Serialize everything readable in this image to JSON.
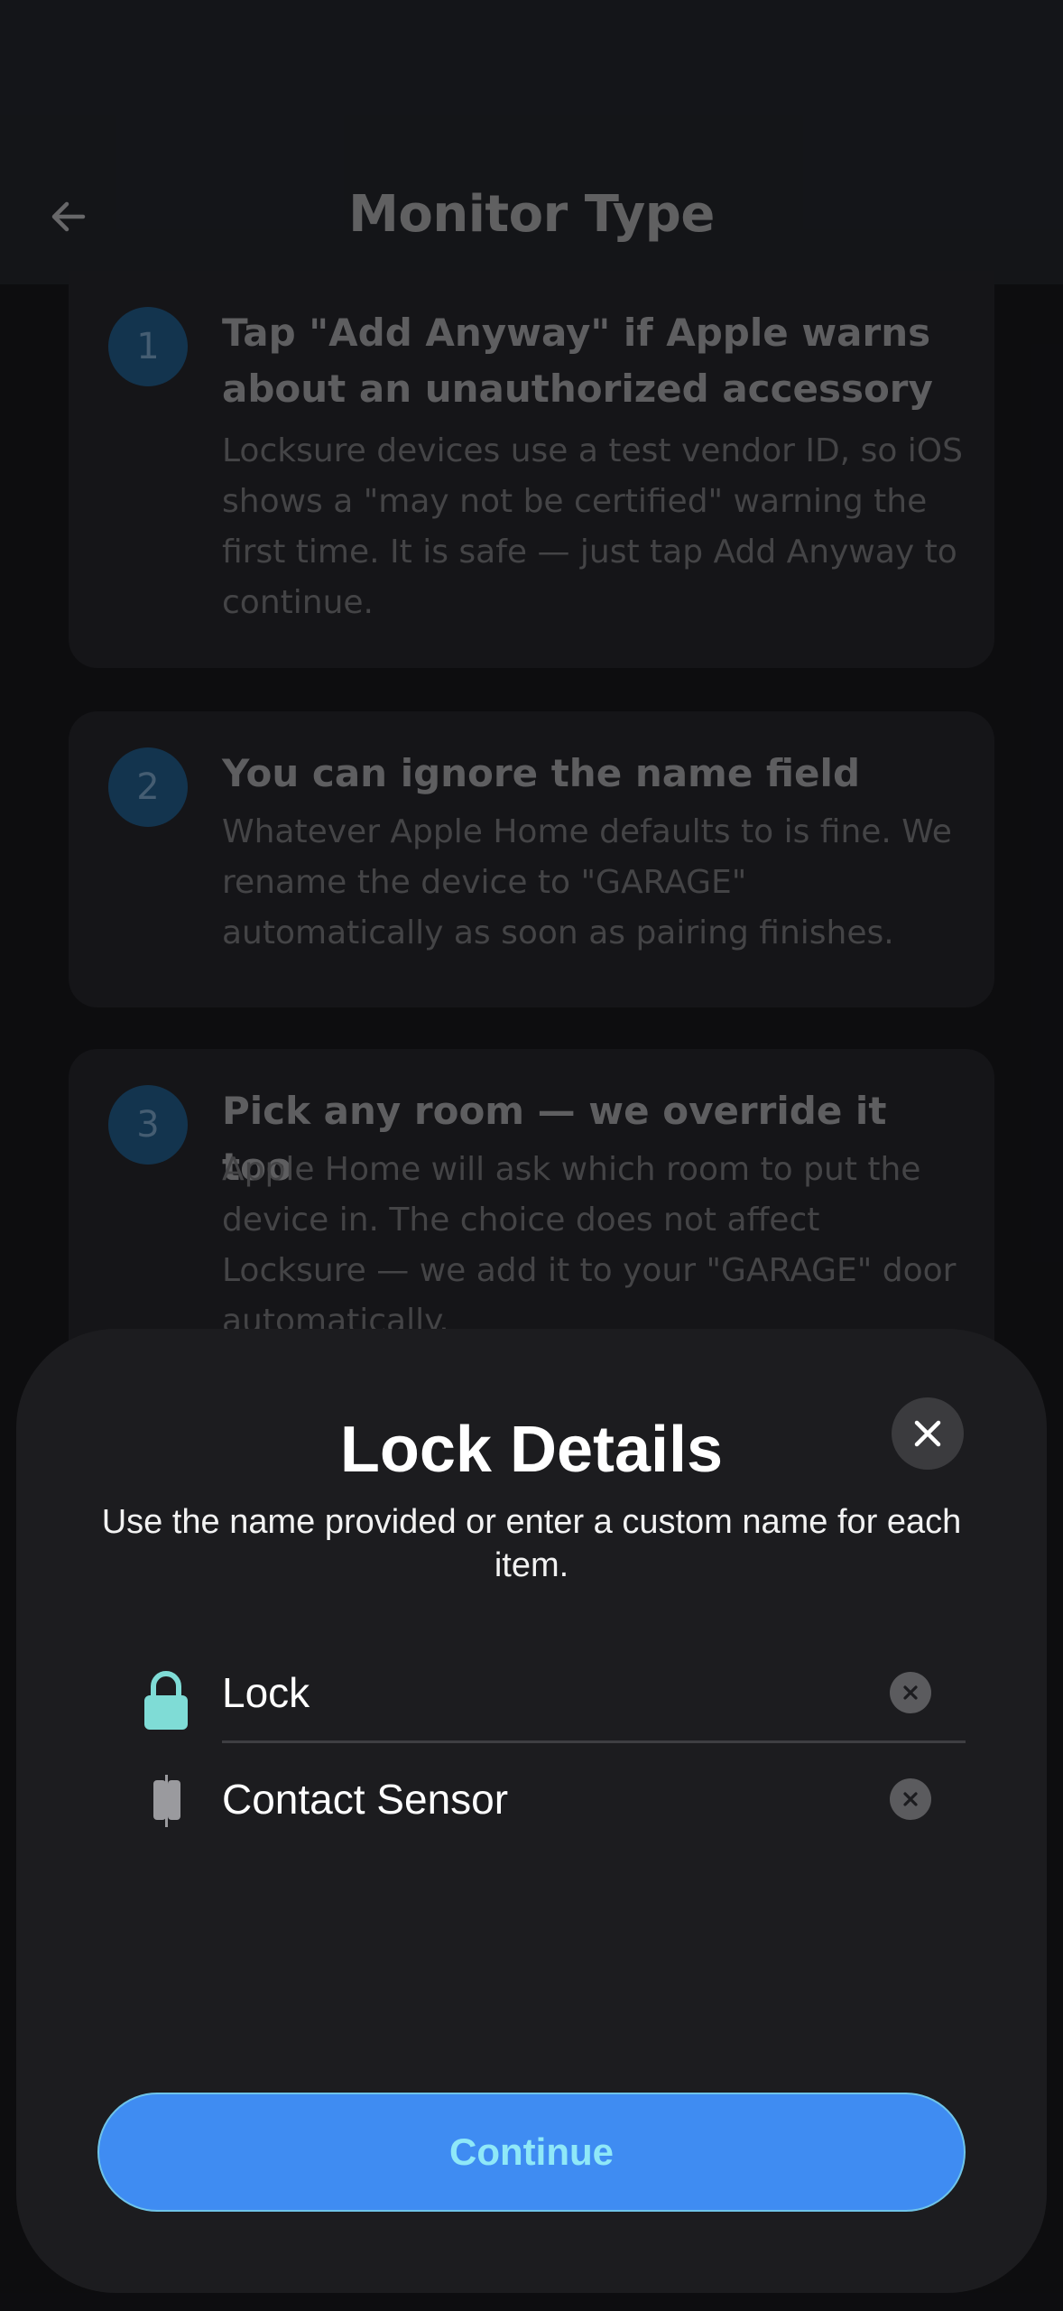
{
  "header": {
    "title": "Monitor Type"
  },
  "steps": [
    {
      "number": "1",
      "title": "Tap \"Add Anyway\" if Apple warns about an unauthorized accessory",
      "body": "Locksure devices use a test vendor ID, so iOS shows a \"may not be certified\" warning the first time. It is safe — just tap Add Anyway to continue."
    },
    {
      "number": "2",
      "title": "You can ignore the name field",
      "body": "Whatever Apple Home defaults to is fine. We rename the device to \"GARAGE\" automatically as soon as pairing finishes."
    },
    {
      "number": "3",
      "title": "Pick any room — we override it too",
      "body": "Apple Home will ask which room to put the device in. The choice does not affect Locksure — we add it to your \"GARAGE\" door automatically."
    }
  ],
  "sheet": {
    "title": "Lock Details",
    "subtitle": "Use the name provided or enter a custom name for each item.",
    "items": [
      {
        "label": "Lock",
        "icon": "lock-icon",
        "icon_color": "#7fdcd6"
      },
      {
        "label": "Contact Sensor",
        "icon": "contact-sensor-icon",
        "icon_color": "#9a9a9e"
      }
    ],
    "continue_label": "Continue"
  },
  "colors": {
    "accent": "#3f8cf2",
    "continue_text": "#8fe8f8",
    "step_badge": "#1a4669"
  }
}
